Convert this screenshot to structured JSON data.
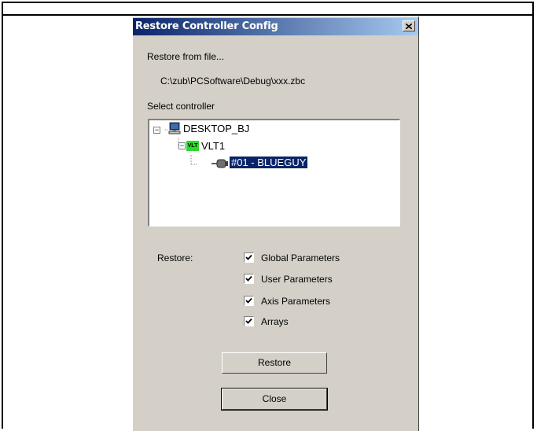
{
  "dialog": {
    "title": "Restore Controller Config",
    "restore_from_label": "Restore from file...",
    "file_path": "C:\\zub\\PCSoftware\\Debug\\xxx.zbc",
    "select_controller_label": "Select controller"
  },
  "tree": {
    "root": {
      "label": "DESKTOP_BJ",
      "icon": "computer-icon"
    },
    "vlt": {
      "label": "VLT1",
      "icon_text": "VLT",
      "icon_color": "#2ed82e"
    },
    "controller": {
      "label": "#01 - BLUEGUY",
      "selected": true
    }
  },
  "restore": {
    "label": "Restore:",
    "options": [
      {
        "label": "Global Parameters",
        "checked": true
      },
      {
        "label": "User Parameters",
        "checked": true
      },
      {
        "label": "Axis Parameters",
        "checked": true
      },
      {
        "label": "Arrays",
        "checked": true
      }
    ]
  },
  "buttons": {
    "restore": "Restore",
    "close": "Close"
  },
  "colors": {
    "title_start": "#0a246a",
    "title_end": "#a6caf0",
    "face": "#d4d0c8",
    "selection": "#0a246a"
  }
}
